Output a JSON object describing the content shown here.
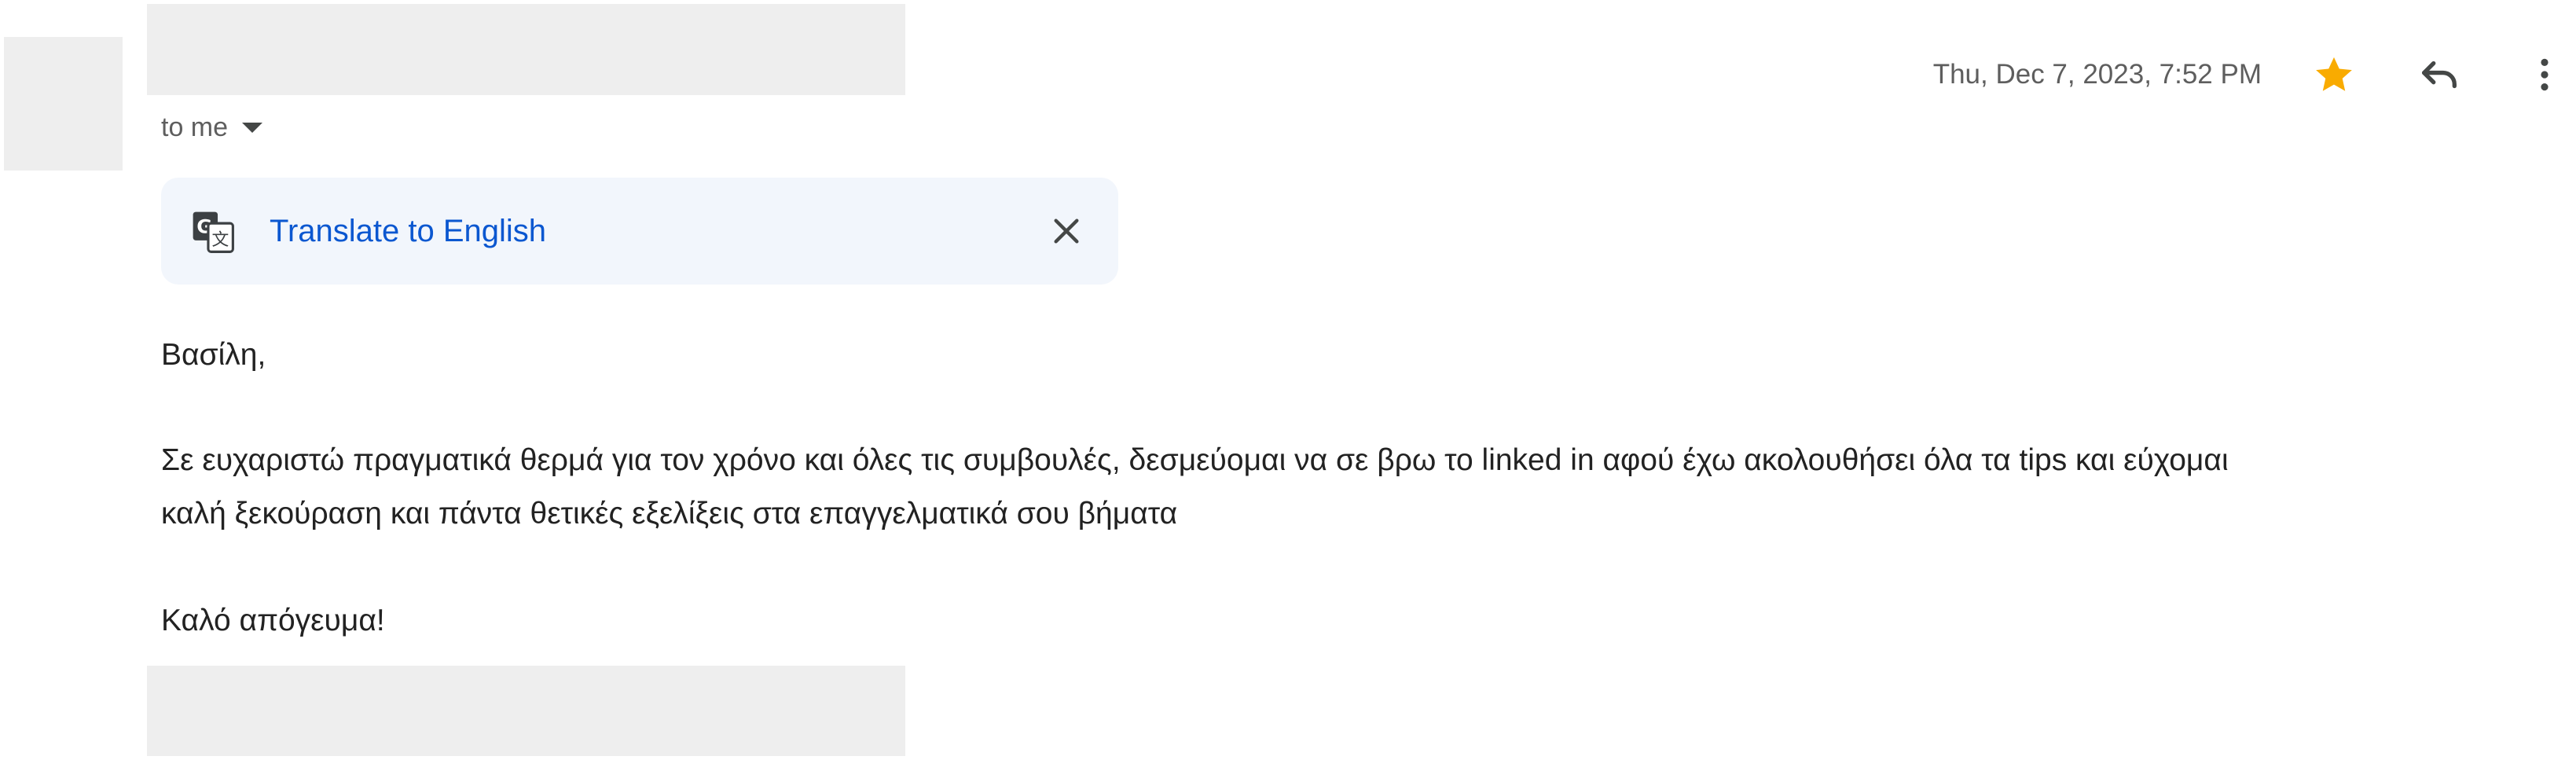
{
  "email": {
    "to_label": "to me",
    "date": "Thu, Dec 7, 2023, 7:52 PM",
    "icons": {
      "star": "star-icon",
      "reply": "reply-icon",
      "more": "more-vert-icon"
    },
    "translate": {
      "link_label": "Translate to English",
      "icon": "translate-icon",
      "close_icon": "close-icon"
    },
    "body": {
      "greeting": "Βασίλη,",
      "paragraph_line1": "Σε ευχαριστώ πραγματικά θερμά για τον χρόνο και όλες τις συμβουλές, δεσμεύομαι να σε βρω το linked in αφού έχω ακολουθήσει όλα τα tips και εύχομαι",
      "paragraph_line2": "καλή ξεκούραση και πάντα θετικές εξελίξεις στα επαγγελματικά σου βήματα",
      "closing": "Καλό απόγευμα!"
    }
  },
  "colors": {
    "star": "#f9ab00",
    "link": "#0b57d0",
    "translate_bg": "#f2f6fc",
    "redaction": "#eeeeee"
  }
}
